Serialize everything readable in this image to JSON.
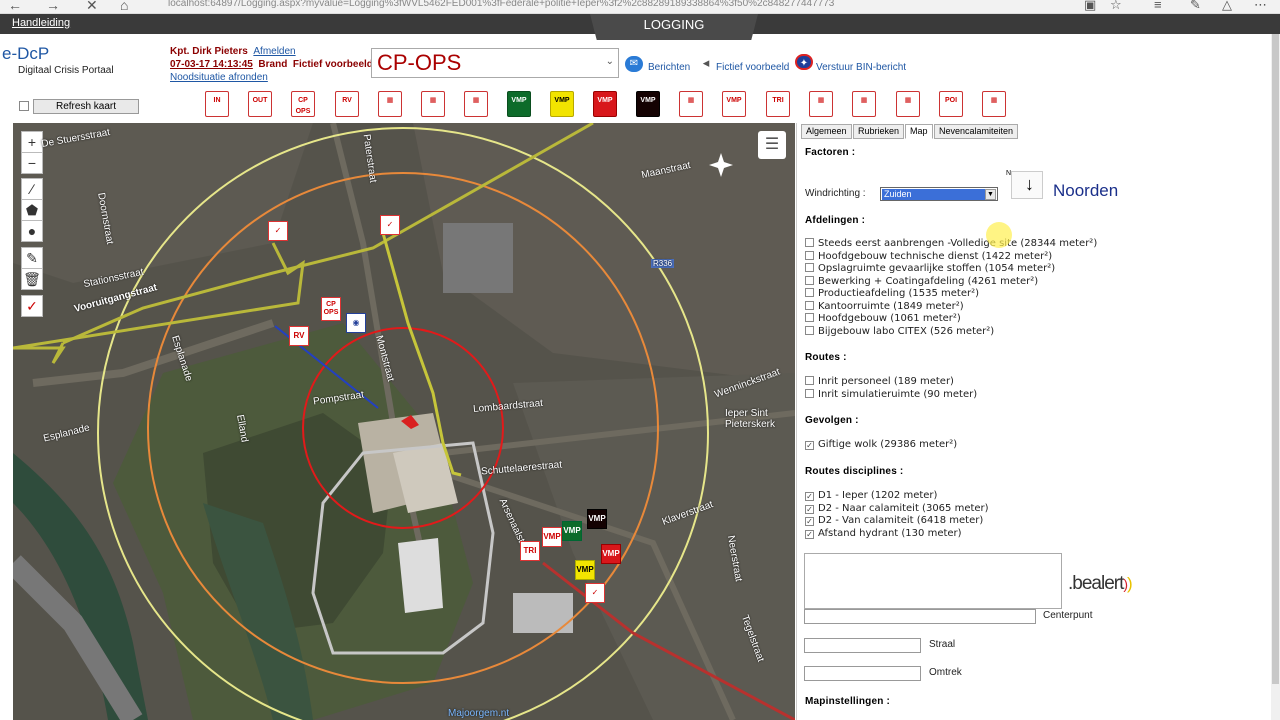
{
  "browser": {
    "url": "localhost:64897/Logging.aspx?myvalue=Logging%3fWVL5462FED001%3fFederale+politie+Ieper%3f2%2c88289189338864%3f50%2c848277447773"
  },
  "topbar": {
    "help_link": "Handleiding",
    "active_tab": "LOGGING"
  },
  "brand": {
    "title": "e-DcP",
    "subtitle": "Digitaal Crisis Portaal"
  },
  "user": {
    "name": "Kpt. Dirk Pieters",
    "logout": "Afmelden",
    "incident_line_date": "07-03-17 14:13:45",
    "incident_line_type": "Brand",
    "incident_line_label": "Fictief voorbeeld",
    "emergency_end": "Noodsituatie afronden"
  },
  "ops_select": {
    "value": "CP-OPS"
  },
  "header_links": {
    "messages": "Berichten",
    "example": "Fictief voorbeeld",
    "bin": "Verstuur BIN-bericht"
  },
  "toolbar": {
    "refresh": "Refresh kaart",
    "buttons": [
      {
        "label": "IN",
        "style": "white"
      },
      {
        "label": "OUT",
        "style": "white"
      },
      {
        "label": "CP OPS",
        "style": "white"
      },
      {
        "label": "RV",
        "style": "white"
      },
      {
        "label": "",
        "style": "white"
      },
      {
        "label": "",
        "style": "white"
      },
      {
        "label": "",
        "style": "white"
      },
      {
        "label": "VMP",
        "style": "green"
      },
      {
        "label": "VMP",
        "style": "yellow"
      },
      {
        "label": "VMP",
        "style": "red"
      },
      {
        "label": "VMP",
        "style": "black"
      },
      {
        "label": "",
        "style": "white"
      },
      {
        "label": "VMP",
        "style": "white"
      },
      {
        "label": "TRI",
        "style": "white"
      },
      {
        "label": "",
        "style": "white"
      },
      {
        "label": "",
        "style": "white"
      },
      {
        "label": "",
        "style": "white"
      },
      {
        "label": "POI",
        "style": "white"
      },
      {
        "label": "",
        "style": "white"
      }
    ]
  },
  "map": {
    "streets": [
      "Stationsstraat",
      "Vooruitgangstraat",
      "Esplanade",
      "Pompstraat",
      "Elland",
      "Esplanade",
      "Lombaardstraat",
      "Schuttelaerestraat",
      "Wenninckstraat",
      "Ieper Sint Pieterskerk",
      "Maanstraat",
      "Klaverstraat",
      "Neerstraat",
      "Tegelstraat",
      "Arsenaalstraat",
      "Doornstraat",
      "De Stuersstraat",
      "Paterstraat",
      "Montstraat",
      "Majoorgem.nt"
    ],
    "road_badge": "R336",
    "markers": [
      {
        "label": "CP OPS",
        "style": "white"
      },
      {
        "label": "RV",
        "style": "white"
      },
      {
        "label": "VMP",
        "style": "white"
      },
      {
        "label": "VMP",
        "style": "green"
      },
      {
        "label": "VMP",
        "style": "black"
      },
      {
        "label": "TRI",
        "style": "white"
      },
      {
        "label": "VMP",
        "style": "red"
      },
      {
        "label": "VMP",
        "style": "yellow"
      }
    ]
  },
  "panel": {
    "tabs": [
      "Algemeen",
      "Rubrieken",
      "Map",
      "Nevencalamiteiten"
    ],
    "active_tab": "Map",
    "factoren_label": "Factoren :",
    "windrichting_label": "Windrichting :",
    "windrichting_value": "Zuiden",
    "compass_letter": "N",
    "north_label": "Noorden",
    "afdelingen_label": "Afdelingen :",
    "afdelingen": [
      "Steeds eerst aanbrengen -Volledige site (28344 meter²)",
      "Hoofdgebouw technische dienst (1422 meter²)",
      "Opslagruimte gevaarlijke stoffen (1054 meter²)",
      "Bewerking + Coatingafdeling (4261 meter²)",
      "Productieafdeling (1535 meter²)",
      "Kantoorruimte (1849 meter²)",
      "Hoofdgebouw (1061 meter²)",
      "Bijgebouw labo CITEX (526 meter²)"
    ],
    "routes_label": "Routes :",
    "routes": [
      "Inrit personeel (189 meter)",
      "Inrit simulatieruimte (90 meter)"
    ],
    "gevolgen_label": "Gevolgen :",
    "gevolgen": [
      "Giftige wolk (29386 meter²)"
    ],
    "disciplines_label": "Routes disciplines :",
    "disciplines": [
      "D1 - Ieper (1202 meter)",
      "D2 - Naar calamiteit (3065 meter)",
      "D2 - Van calamiteit (6418 meter)",
      "Afstand hydrant (130 meter)"
    ],
    "centerpunt_label": "Centerpunt",
    "straal_label": "Straal",
    "omtrek_label": "Omtrek",
    "bealert_logo": ".bealert",
    "mapinstellingen_label": "Mapinstellingen :"
  }
}
